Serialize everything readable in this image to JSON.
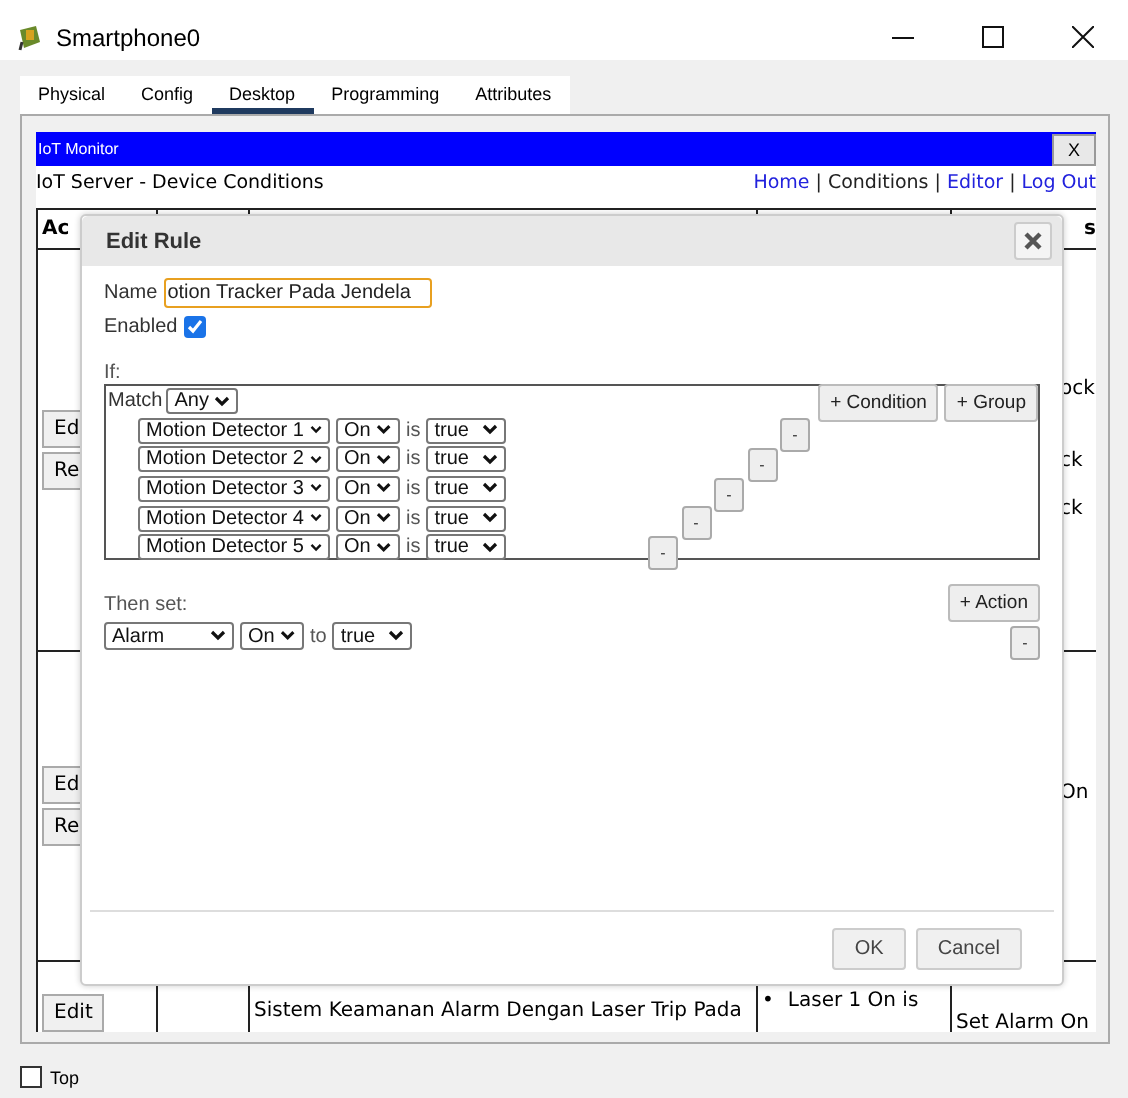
{
  "window": {
    "title": "Smartphone0"
  },
  "tabs": [
    {
      "label": "Physical",
      "selected": false
    },
    {
      "label": "Config",
      "selected": false
    },
    {
      "label": "Desktop",
      "selected": true
    },
    {
      "label": "Programming",
      "selected": false
    },
    {
      "label": "Attributes",
      "selected": false
    }
  ],
  "app": {
    "title": "IoT Monitor",
    "close": "X",
    "heading": "IoT Server - Device Conditions",
    "separator": "|",
    "nav": [
      {
        "label": "Home",
        "selected": false
      },
      {
        "label": "Conditions",
        "selected": true
      },
      {
        "label": "Editor",
        "selected": false
      },
      {
        "label": "Log Out",
        "selected": false
      }
    ]
  },
  "table": {
    "column_1": "Ac",
    "column_5": "s",
    "rows": [
      {
        "buttons": [
          "Ed",
          "Re"
        ],
        "column_5": [
          "ock",
          "ck",
          "ck"
        ]
      },
      {
        "buttons": [
          "Ed",
          "Re"
        ],
        "column_5": [
          "On"
        ]
      },
      {
        "buttons": [
          "Edit"
        ],
        "column_3": "Sistem Keamanan Alarm Dengan Laser Trip Pada",
        "bullet": "•",
        "column_4": "Laser 1 On is",
        "column_5": [
          "Set Alarm On"
        ]
      }
    ]
  },
  "dialog": {
    "title": "Edit Rule",
    "name_label": "Name",
    "name_value": "otion Tracker Pada Jendela",
    "enabled_label": "Enabled",
    "enabled": true,
    "if_label": "If:",
    "match_label": "Match",
    "match": "Any",
    "add_condition": "+ Condition",
    "add_group": "+ Group",
    "conditions": [
      {
        "device": "Motion Detector 1",
        "property": "On",
        "is_label": "is",
        "value": "true",
        "remove": "-"
      },
      {
        "device": "Motion Detector 2",
        "property": "On",
        "is_label": "is",
        "value": "true",
        "remove": "-"
      },
      {
        "device": "Motion Detector 3",
        "property": "On",
        "is_label": "is",
        "value": "true",
        "remove": "-"
      },
      {
        "device": "Motion Detector 4",
        "property": "On",
        "is_label": "is",
        "value": "true",
        "remove": "-"
      },
      {
        "device": "Motion Detector 5",
        "property": "On",
        "is_label": "is",
        "value": "true",
        "remove": "-"
      }
    ],
    "then_label": "Then set:",
    "add_action": "+ Action",
    "actions": [
      {
        "device": "Alarm",
        "property": "On",
        "to_label": "to",
        "value": "true",
        "remove": "-"
      }
    ],
    "buttons": [
      "OK",
      "Cancel"
    ]
  },
  "footer": {
    "label": "Top",
    "checked": false
  }
}
